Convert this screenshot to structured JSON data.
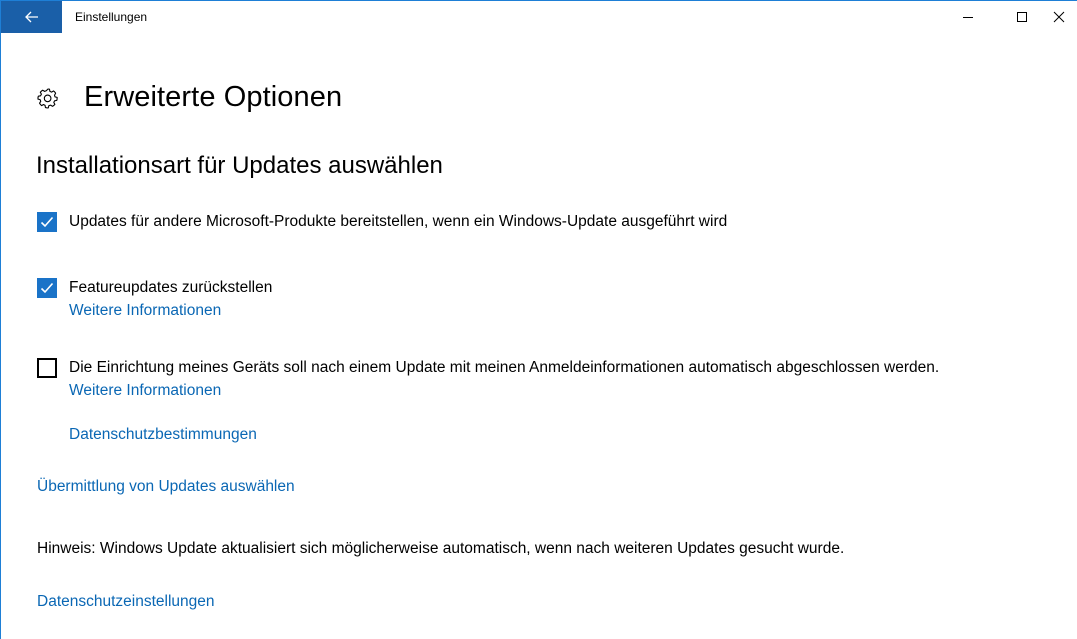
{
  "window": {
    "title": "Einstellungen"
  },
  "header": {
    "title": "Erweiterte Optionen",
    "icon": "gear-icon"
  },
  "section": {
    "title": "Installationsart für Updates auswählen"
  },
  "options": [
    {
      "label": "Updates für andere Microsoft-Produkte bereitstellen, wenn ein Windows-Update ausgeführt wird",
      "checked": true
    },
    {
      "label": "Featureupdates zurückstellen",
      "checked": true,
      "link": "Weitere Informationen"
    },
    {
      "label": "Die Einrichtung meines Geräts soll nach einem Update mit meinen Anmeldeinformationen automatisch abgeschlossen werden.",
      "checked": false,
      "link": "Weitere Informationen",
      "link2": "Datenschutzbestimmungen"
    }
  ],
  "links": {
    "delivery": "Übermittlung von Updates auswählen",
    "privacy_settings": "Datenschutzeinstellungen"
  },
  "note": "Hinweis: Windows Update aktualisiert sich möglicherweise automatisch, wenn nach weiteren Updates gesucht wurde.",
  "colors": {
    "accent": "#1a73c8",
    "titlebar_back": "#1a5fa8",
    "link": "#0a67b4"
  }
}
